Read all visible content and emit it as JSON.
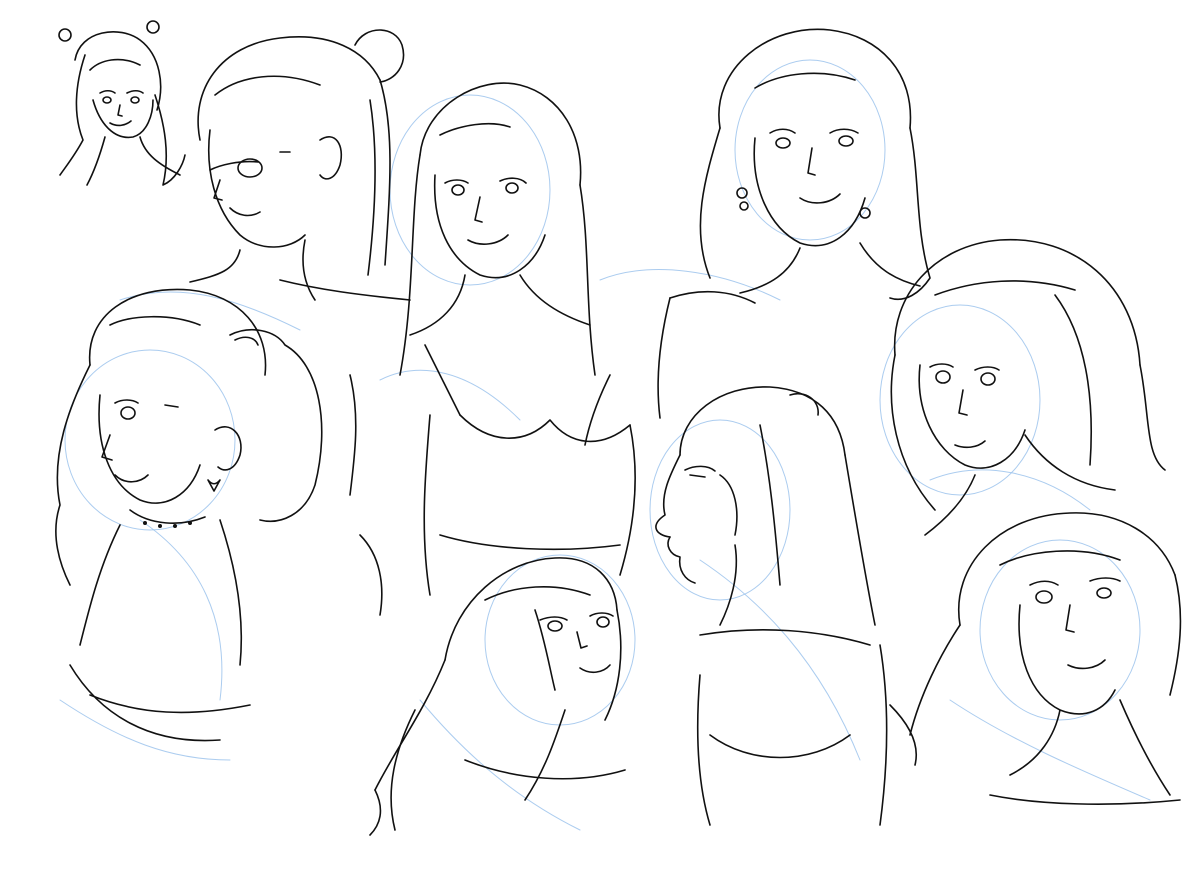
{
  "canvas": {
    "background": "#ffffff",
    "ink_color": "#111111",
    "guide_color": "#9cc3ec"
  },
  "sheet": {
    "kind": "character sketch sheet",
    "figures": [
      {
        "id": "small-thumbnail",
        "icon": "portrait-sketch"
      },
      {
        "id": "bun-ponytail-three-quarter",
        "icon": "portrait-sketch"
      },
      {
        "id": "long-hair-front-center",
        "icon": "portrait-sketch"
      },
      {
        "id": "wavy-hair-earrings",
        "icon": "portrait-sketch"
      },
      {
        "id": "pigtails-choker",
        "icon": "portrait-sketch"
      },
      {
        "id": "bob-cut-right",
        "icon": "portrait-sketch"
      },
      {
        "id": "profile-view-middle",
        "icon": "portrait-sketch"
      },
      {
        "id": "looking-up-bottom",
        "icon": "portrait-sketch"
      },
      {
        "id": "wavy-hair-bottom-right",
        "icon": "portrait-sketch"
      }
    ]
  }
}
